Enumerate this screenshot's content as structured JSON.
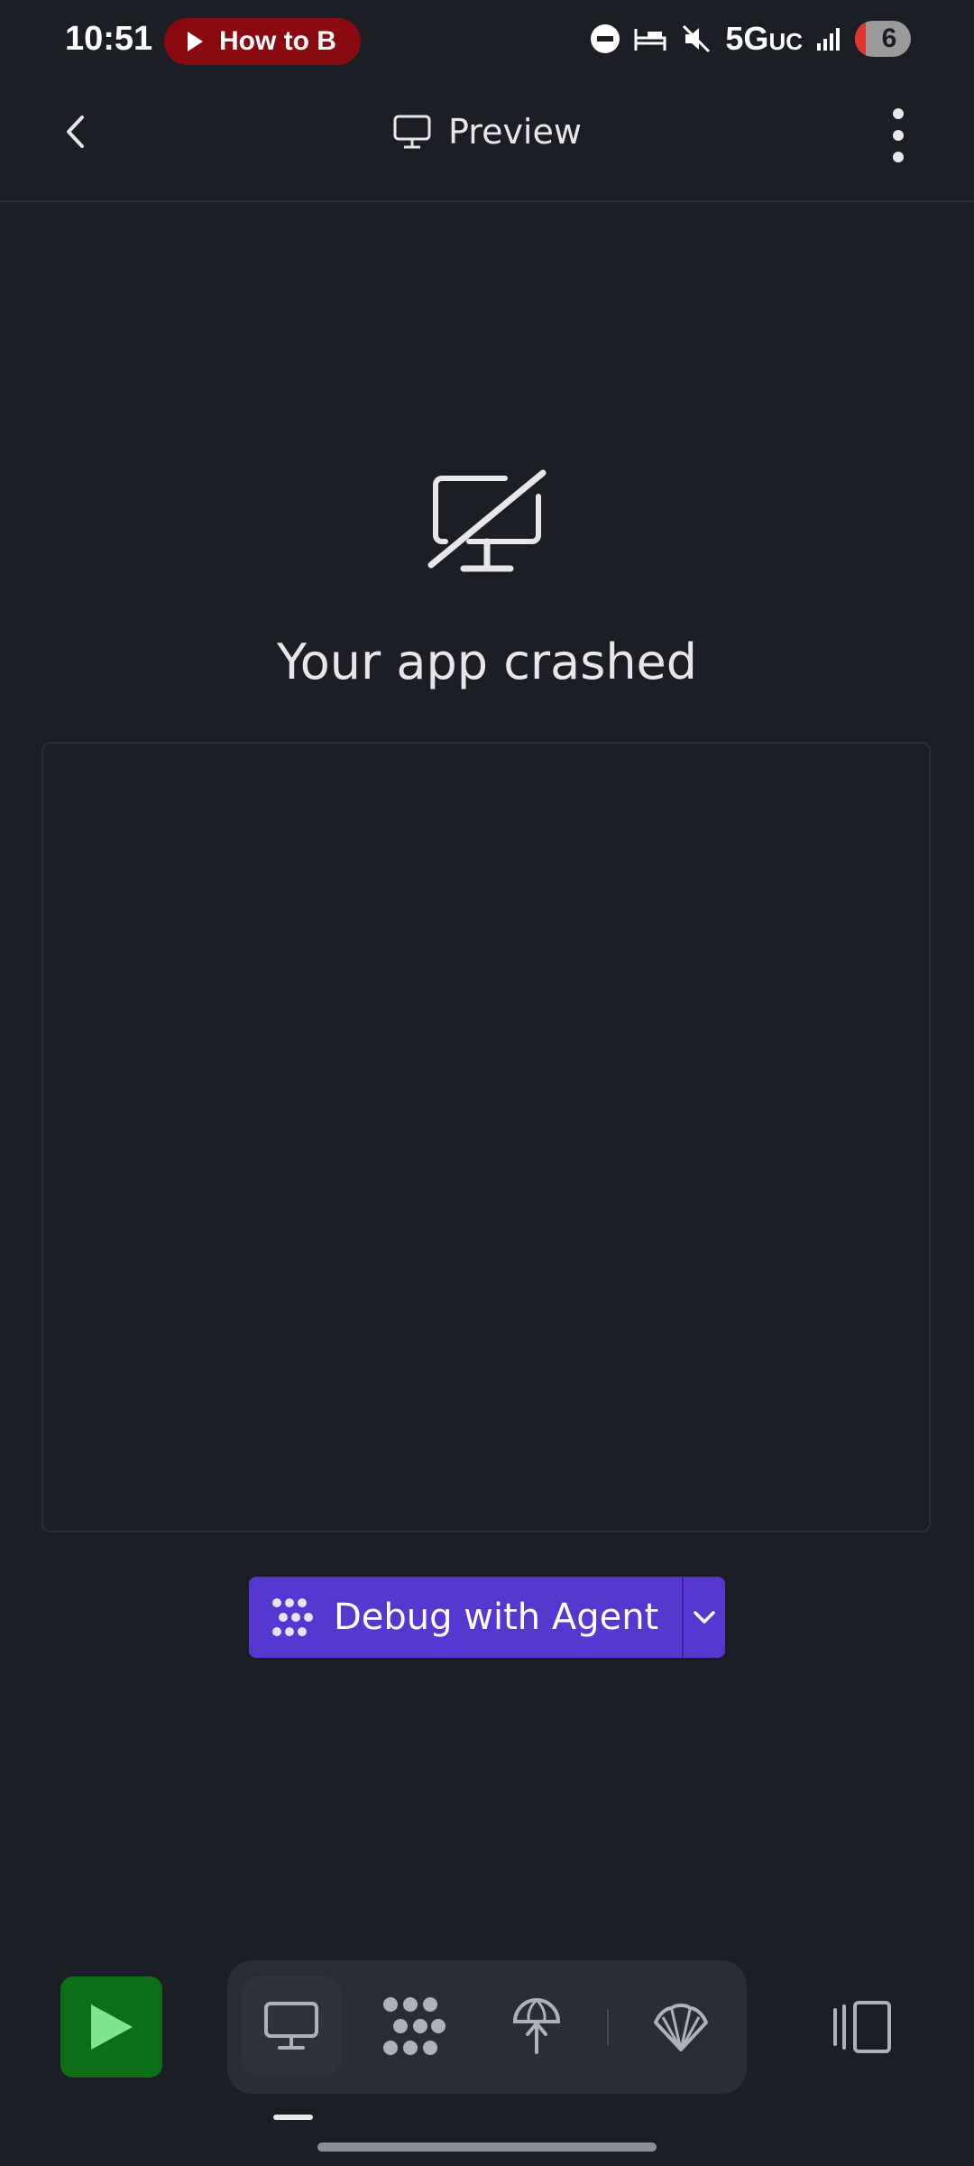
{
  "status_bar": {
    "time": "10:51",
    "media_pill": "How to B",
    "network": "5G",
    "network_suffix": "UC",
    "battery": "6"
  },
  "header": {
    "title": "Preview",
    "icons": [
      "back-chevron-icon",
      "monitor-icon",
      "kebab-menu-icon"
    ]
  },
  "crash": {
    "title": "Your app crashed",
    "icon": "monitor-off-icon",
    "log": ""
  },
  "debug_button": {
    "label": "Debug with Agent",
    "icon": "agent-icon",
    "dropdown_icon": "chevron-down-icon"
  },
  "bottom_bar": {
    "run_icon": "play-icon",
    "tabs": [
      "preview-tab",
      "agent-tab",
      "deploy-tab",
      "shell-tab"
    ],
    "active_tab": "preview-tab",
    "toggle_icon": "panel-toggle-icon"
  },
  "colors": {
    "background": "#1c1e26",
    "accent": "#5637d0",
    "run_green": "#0d6e18",
    "run_icon": "#7ee58a"
  }
}
